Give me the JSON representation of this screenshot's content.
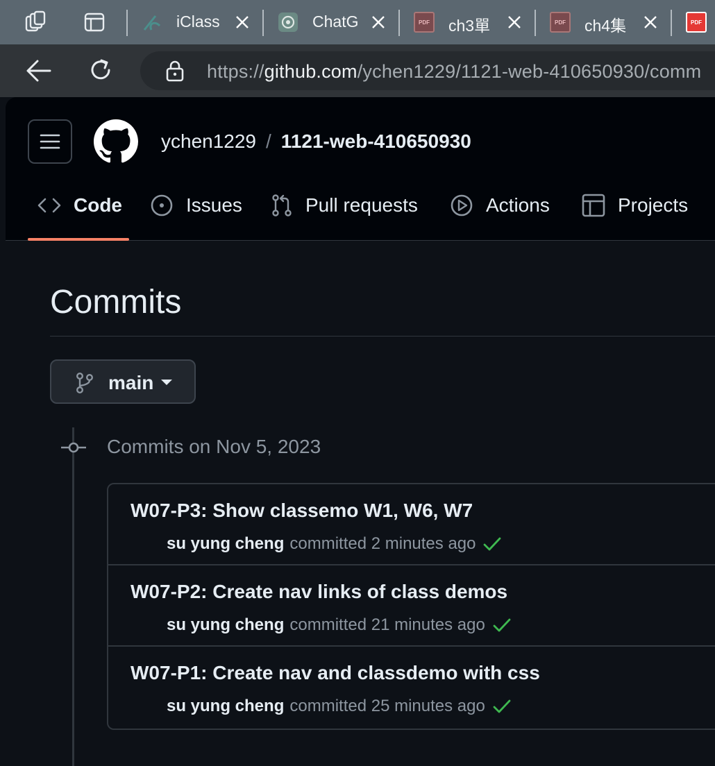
{
  "browser": {
    "tabs": [
      {
        "title": "iClass"
      },
      {
        "title": "ChatG"
      },
      {
        "title": "ch3單"
      },
      {
        "title": "ch4集"
      }
    ],
    "url": {
      "scheme": "https://",
      "host": "github.com",
      "path": "/ychen1229/1121-web-410650930/comm"
    }
  },
  "repo": {
    "owner": "ychen1229",
    "separator": "/",
    "name": "1121-web-410650930"
  },
  "nav": {
    "tabs": [
      {
        "label": "Code"
      },
      {
        "label": "Issues"
      },
      {
        "label": "Pull requests"
      },
      {
        "label": "Actions"
      },
      {
        "label": "Projects"
      }
    ]
  },
  "page": {
    "title": "Commits",
    "branch": "main",
    "day_header": "Commits on Nov 5, 2023"
  },
  "commits": [
    {
      "message": "W07-P3: Show classemo W1, W6, W7",
      "author": "su yung cheng",
      "time": "committed 2 minutes ago"
    },
    {
      "message": "W07-P2: Create nav links of class demos",
      "author": "su yung cheng",
      "time": "committed 21 minutes ago"
    },
    {
      "message": "W07-P1: Create nav and classdemo with css",
      "author": "su yung cheng",
      "time": "committed 25 minutes ago"
    }
  ],
  "colors": {
    "accent_underline": "#f78166",
    "check": "#3fb950",
    "bg": "#0d1117"
  }
}
